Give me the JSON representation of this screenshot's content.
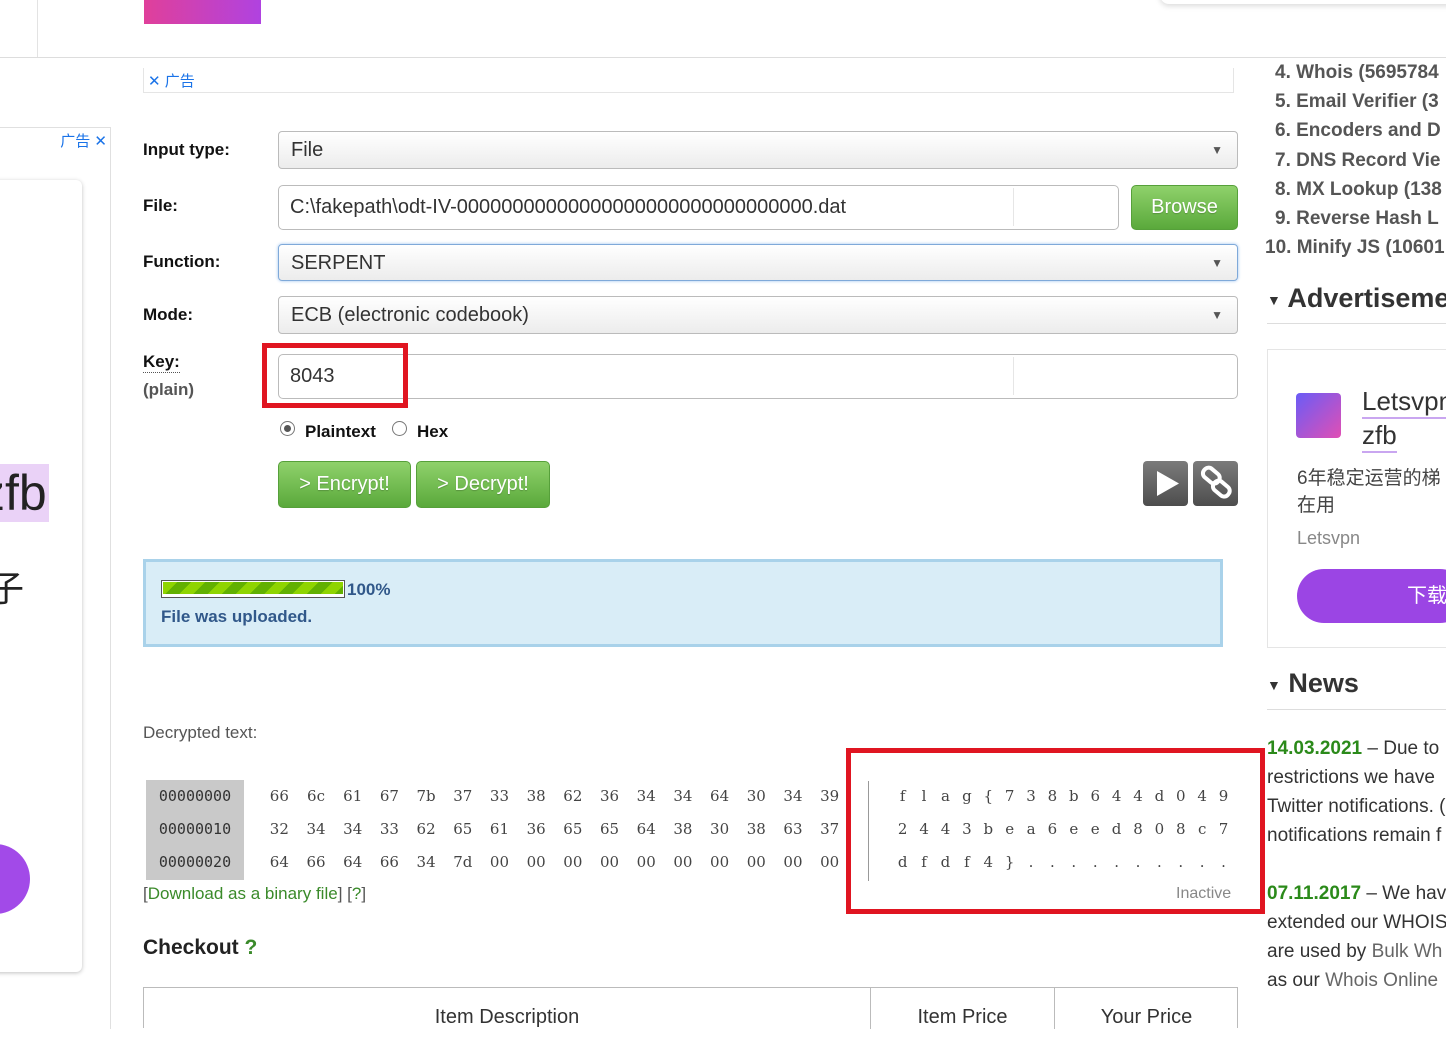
{
  "ads": {
    "label": "广告",
    "left_big_text": "zfb",
    "left_cn_char": "子",
    "right": {
      "title_line1": "Letsvpn",
      "title_line2": "zfb",
      "desc_line1": "6年稳定运营的梯",
      "desc_line2": "在用",
      "brand": "Letsvpn",
      "button": "下载"
    }
  },
  "form": {
    "input_type_label": "Input type:",
    "input_type_value": "File",
    "file_label": "File:",
    "file_value": "C:\\fakepath\\odt-IV-00000000000000000000000000000000.dat",
    "browse_label": "Browse",
    "function_label": "Function:",
    "function_value": "SERPENT",
    "mode_label": "Mode:",
    "mode_value": "ECB (electronic codebook)",
    "key_label": "Key:",
    "key_sublabel": "(plain)",
    "key_value": "8043",
    "radio_plaintext": "Plaintext",
    "radio_hex": "Hex",
    "encrypt_label": "> Encrypt!",
    "decrypt_label": "> Decrypt!"
  },
  "upload": {
    "progress_percent": 100,
    "progress_text": "100%",
    "message": "File was uploaded."
  },
  "decrypted": {
    "heading": "Decrypted text:",
    "rows": [
      {
        "offset": "00000000",
        "hex": [
          "66",
          "6c",
          "61",
          "67",
          "7b",
          "37",
          "33",
          "38",
          "62",
          "36",
          "34",
          "34",
          "64",
          "30",
          "34",
          "39"
        ],
        "ascii": [
          "f",
          "l",
          "a",
          "g",
          "{",
          "7",
          "3",
          "8",
          "b",
          "6",
          "4",
          "4",
          "d",
          "0",
          "4",
          "9"
        ]
      },
      {
        "offset": "00000010",
        "hex": [
          "32",
          "34",
          "34",
          "33",
          "62",
          "65",
          "61",
          "36",
          "65",
          "65",
          "64",
          "38",
          "30",
          "38",
          "63",
          "37"
        ],
        "ascii": [
          "2",
          "4",
          "4",
          "3",
          "b",
          "e",
          "a",
          "6",
          "e",
          "e",
          "d",
          "8",
          "0",
          "8",
          "c",
          "7"
        ]
      },
      {
        "offset": "00000020",
        "hex": [
          "64",
          "66",
          "64",
          "66",
          "34",
          "7d",
          "00",
          "00",
          "00",
          "00",
          "00",
          "00",
          "00",
          "00",
          "00",
          "00"
        ],
        "ascii": [
          "d",
          "f",
          "d",
          "f",
          "4",
          "}",
          ".",
          ".",
          ".",
          ".",
          ".",
          ".",
          ".",
          ".",
          ".",
          "."
        ]
      }
    ],
    "download_link": "Download as a binary file",
    "help_link": "?",
    "status": "Inactive"
  },
  "checkout": {
    "title": "Checkout",
    "help": "?",
    "columns": [
      "Item Description",
      "Item Price",
      "Your Price"
    ]
  },
  "sidebar": {
    "popular": [
      "4. Whois (5695784",
      "5. Email Verifier (3",
      "6. Encoders and D",
      "7. DNS Record Vie",
      "8. MX Lookup (138",
      "9. Reverse Hash L",
      "10. Minify JS (10601"
    ],
    "ads_heading": "Advertiseme",
    "news_heading": "News",
    "news": [
      {
        "date": "14.03.2021",
        "lines": [
          " – Due to",
          "restrictions we have",
          "Twitter notifications. (",
          "notifications remain f"
        ]
      },
      {
        "date": "07.11.2017",
        "lines": [
          " – We hav",
          "extended our WHOIS",
          "are used by ",
          "as our "
        ],
        "links": [
          "Bulk Wh",
          "Whois Online"
        ]
      }
    ]
  },
  "colors": {
    "green_button": "#5aa93b",
    "highlight_red": "#e01521",
    "info_bg": "#d9edf7",
    "news_date": "#2b8a1a"
  }
}
